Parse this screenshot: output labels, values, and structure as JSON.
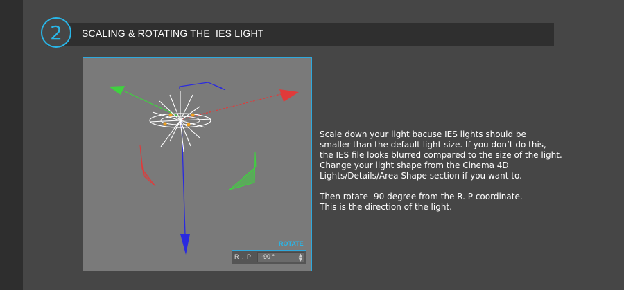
{
  "header": {
    "step_number": "2",
    "title": "SCALING & ROTATING THE  IES LIGHT"
  },
  "viewport": {
    "rotate_label": "ROTATE",
    "coordinate_label": "R . P",
    "coordinate_value": "-90 °"
  },
  "description": {
    "paragraph1": "Scale down your light bacuse IES lights should be\nsmaller than the default light size. If you don’t do this,\nthe IES file looks blurred compared to the size of the light.\nChange your light shape from the Cinema 4D\nLights/Details/Area Shape section if you want to.",
    "paragraph2": "Then rotate -90 degree from the R. P coordinate.\nThis is the direction of the light."
  },
  "colors": {
    "accent": "#29b6e8",
    "x_axis": "#e03a3a",
    "y_axis": "#3fd13f",
    "z_axis": "#2a2ae0"
  },
  "icons": {
    "stepper": "up-down-arrows"
  }
}
